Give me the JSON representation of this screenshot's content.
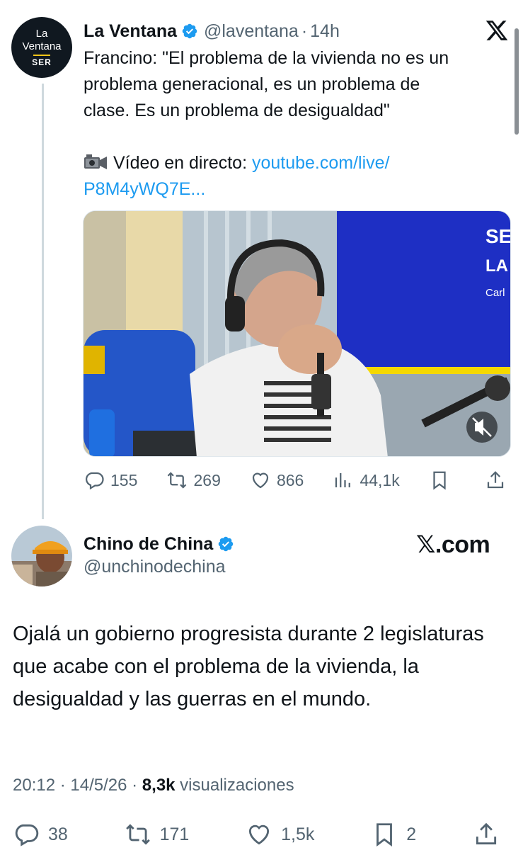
{
  "tweet1": {
    "display_name": "La Ventana",
    "handle": "@laventana",
    "time_sep": "·",
    "time": "14h",
    "avatar": {
      "line1": "La",
      "line2": "Ventana",
      "line3": "SER"
    },
    "text_line1": "Francino: \"El problema de la vivienda no es un",
    "text_line2": "problema generacional, es un problema de",
    "text_line3": "clase. Es un problema de desigualdad\"",
    "video_prefix": "Vídeo en directo: ",
    "link_part1": "youtube.com/live/",
    "link_part2": "P8M4yWQ7E...",
    "media_overlay": {
      "brand1": "SE",
      "brand2": "LA",
      "brand3": "Carl"
    },
    "actions": {
      "replies": "155",
      "retweets": "269",
      "likes": "866",
      "views": "44,1k"
    }
  },
  "tweet2": {
    "display_name": "Chino de China",
    "handle": "@unchinodechina",
    "watermark": "𝕏.com",
    "text": "Ojalá un gobierno progresista durante 2 legislaturas que acabe con el problema de la vivienda, la desigualdad y las guerras en el mundo.",
    "meta": {
      "time": "20:12",
      "sep1": " · ",
      "date": "14/5/26",
      "sep2": " · ",
      "views": "8,3k",
      "views_label": " visualizaciones"
    },
    "actions": {
      "replies": "38",
      "retweets": "171",
      "likes": "1,5k",
      "bookmarks": "2"
    }
  },
  "icons": {
    "verified": "verified-badge-icon",
    "x_logo": "x-logo-icon",
    "camera": "video-camera-icon",
    "reply": "reply-icon",
    "retweet": "retweet-icon",
    "like": "heart-icon",
    "views": "views-bar-chart-icon",
    "bookmark": "bookmark-icon",
    "share": "share-icon",
    "mute": "muted-speaker-icon"
  },
  "colors": {
    "link": "#1d9bf0",
    "verified": "#1d9bf0",
    "text_primary": "#0f1419",
    "text_secondary": "#536471"
  }
}
